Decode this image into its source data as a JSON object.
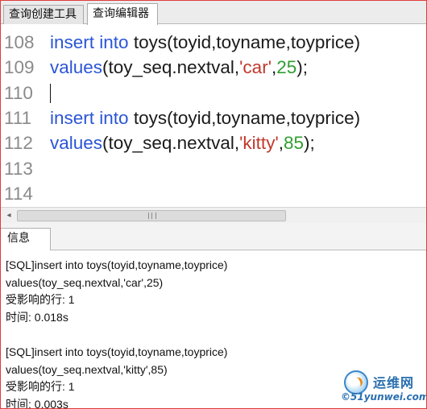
{
  "tabs": [
    "查询创建工具",
    "查询编辑器"
  ],
  "active_tab": "查询编辑器",
  "editor": {
    "lines": [
      {
        "no": "108",
        "parts": [
          [
            "kw",
            "insert into"
          ],
          [
            "plain",
            " toys(toyid,toyname,toyprice)"
          ]
        ]
      },
      {
        "no": "109",
        "parts": [
          [
            "kw",
            "values"
          ],
          [
            "plain",
            "(toy_seq.nextval,"
          ],
          [
            "str",
            "'car'"
          ],
          [
            "plain",
            ","
          ],
          [
            "num",
            "25"
          ],
          [
            "plain",
            ");"
          ]
        ]
      },
      {
        "no": "110",
        "parts": [],
        "caret": true
      },
      {
        "no": "111",
        "parts": [
          [
            "kw",
            "insert into"
          ],
          [
            "plain",
            " toys(toyid,toyname,toyprice)"
          ]
        ]
      },
      {
        "no": "112",
        "parts": [
          [
            "kw",
            "values"
          ],
          [
            "plain",
            "(toy_seq.nextval,"
          ],
          [
            "str",
            "'kitty'"
          ],
          [
            "plain",
            ","
          ],
          [
            "num",
            "85"
          ],
          [
            "plain",
            ");"
          ]
        ]
      },
      {
        "no": "113",
        "parts": []
      },
      {
        "no": "114",
        "parts": []
      }
    ]
  },
  "scrollbar": {
    "left_arrow": "◂"
  },
  "info_panel": {
    "tab_label": "信息",
    "lines": [
      "[SQL]insert into toys(toyid,toyname,toyprice)",
      "values(toy_seq.nextval,'car',25)",
      "受影响的行: 1",
      "时间: 0.018s",
      "",
      "[SQL]insert into toys(toyid,toyname,toyprice)",
      "values(toy_seq.nextval,'kitty',85)",
      "受影响的行: 1",
      "时间: 0.003s"
    ]
  },
  "watermark": {
    "name": "运维网",
    "site": "©51yunwei.com"
  },
  "colors": {
    "keyword": "#2b55d6",
    "string": "#c0392b",
    "number": "#2f9e2f",
    "line_number": "#8a8a8a"
  }
}
